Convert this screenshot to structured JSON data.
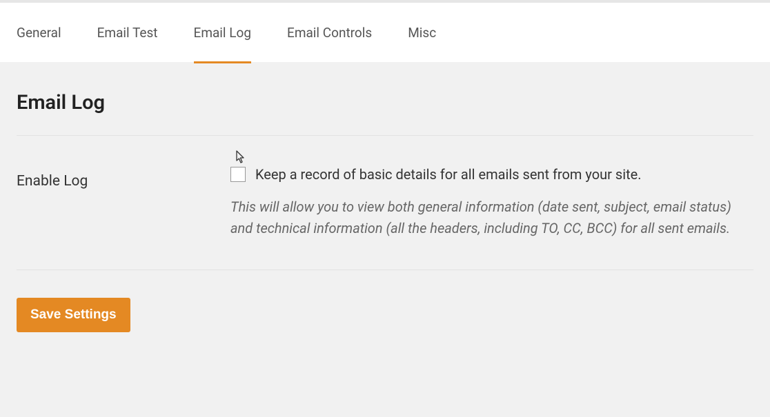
{
  "tabs": {
    "items": [
      {
        "label": "General"
      },
      {
        "label": "Email Test"
      },
      {
        "label": "Email Log"
      },
      {
        "label": "Email Controls"
      },
      {
        "label": "Misc"
      }
    ],
    "active_index": 2
  },
  "page": {
    "title": "Email Log"
  },
  "settings": {
    "enable_log": {
      "label": "Enable Log",
      "checkbox_label": "Keep a record of basic details for all emails sent from your site.",
      "description": "This will allow you to view both general information (date sent, subject, email status) and technical information (all the headers, including TO, CC, BCC) for all sent emails.",
      "checked": false
    }
  },
  "buttons": {
    "save": "Save Settings"
  },
  "colors": {
    "accent": "#e48923",
    "bg": "#f1f1f1",
    "tab_bg": "#ffffff"
  }
}
